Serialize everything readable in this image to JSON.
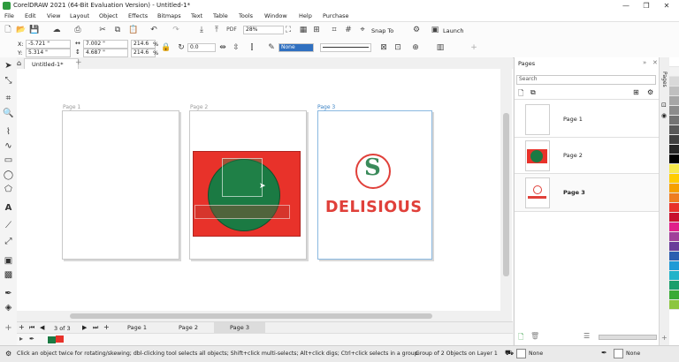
{
  "app": {
    "title": "CorelDRAW 2021 (64-Bit Evaluation Version) - Untitled-1*"
  },
  "window": {
    "minimize": "—",
    "restore": "❐",
    "close": "✕"
  },
  "menu": [
    "File",
    "Edit",
    "View",
    "Layout",
    "Object",
    "Effects",
    "Bitmaps",
    "Text",
    "Table",
    "Tools",
    "Window",
    "Help",
    "Purchase"
  ],
  "toolbar": {
    "zoom": "28%",
    "snap_to": "Snap To",
    "launch": "Launch"
  },
  "property_bar": {
    "x_label": "X:",
    "x_value": "-5.721 \"",
    "y_label": "Y:",
    "y_value": "5.314 \"",
    "width_value": "7.002 \"",
    "height_value": "4.687 \"",
    "scale_x": "214.6",
    "scale_y": "214.6",
    "percent": "%",
    "rotation": "0.0",
    "fill_value": "None"
  },
  "document": {
    "tab_label": "Untitled-1*",
    "add_tab": "+"
  },
  "canvas": {
    "pages": [
      {
        "label": "Page 1"
      },
      {
        "label": "Page 2"
      },
      {
        "label": "Page 3"
      }
    ],
    "logo_text": "DELISIOUS",
    "logo_letter": "S",
    "colors": {
      "red": "#e8322a",
      "green": "#1b7a43",
      "logo_red": "#e0403a",
      "page3_border": "#8ab8e0"
    }
  },
  "page_nav": {
    "counter": "3 of 3",
    "tabs": [
      "Page 1",
      "Page 2",
      "Page 3"
    ],
    "active": "Page 3"
  },
  "pages_panel": {
    "title": "Pages",
    "search_placeholder": "Search",
    "items": [
      {
        "label": "Page 1"
      },
      {
        "label": "Page 2"
      },
      {
        "label": "Page 3"
      }
    ]
  },
  "side_tab": "Pages",
  "status": {
    "hint": "Click an object twice for rotating/skewing; dbl-clicking tool selects all objects; Shift+click multi-selects; Alt+click digs; Ctrl+click selects in a group",
    "selection": "Group of 2 Objects on Layer 1",
    "fill": "None",
    "outline": "None"
  },
  "palette": [
    "#ffffff",
    "#f2f2f2",
    "#d9d9d9",
    "#bfbfbf",
    "#a6a6a6",
    "#8c8c8c",
    "#737373",
    "#595959",
    "#404040",
    "#262626",
    "#000000",
    "#f7e94b",
    "#ffcc00",
    "#f5a000",
    "#ee7d20",
    "#e8322a",
    "#c8102e",
    "#e0208a",
    "#a0409a",
    "#6a3d9a",
    "#2b5fb0",
    "#1f9ad6",
    "#22b3c9",
    "#1b9e6b",
    "#3aaa35",
    "#8cc63f"
  ]
}
